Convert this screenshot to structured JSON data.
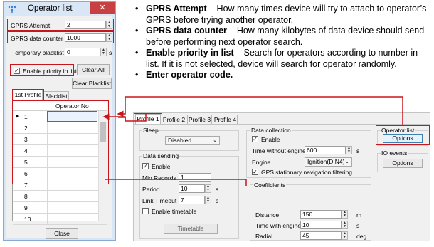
{
  "dialog": {
    "title": "Operator list",
    "close_glyph": "✕",
    "gprs_attempt": {
      "label": "GPRS Attempt",
      "value": "2"
    },
    "gprs_counter": {
      "label": "GPRS data counter",
      "value": "1000"
    },
    "temp_blacklist": {
      "label": "Temporary blacklist",
      "value": "0",
      "unit": "s"
    },
    "enable_priority": {
      "label": "Enable priority in list",
      "checked": true
    },
    "clear_all": "Clear All",
    "clear_blacklist": "Clear Blacklist",
    "tabs": [
      "1st Profile",
      "Blacklist"
    ],
    "grid_header": "Operator No",
    "row_numbers": [
      "1",
      "2",
      "3",
      "4",
      "5",
      "6",
      "7",
      "8",
      "9",
      "10"
    ],
    "close_button": "Close"
  },
  "bullets": [
    {
      "bold": "GPRS Attempt",
      "text": " – How many times device will try to attach to operator’s GPRS before trying another operator."
    },
    {
      "bold": "GPRS data counter",
      "text": " – How many kilobytes of data device should send before performing next operator search."
    },
    {
      "bold": "Enable priority in list",
      "text": " – Search for operators according to number in list. If it is not selected, device will search for operator randomly."
    },
    {
      "bold": "Enter operator code.",
      "text": ""
    }
  ],
  "panel": {
    "tabs": [
      "Profile 1",
      "Profile 2",
      "Profile 3",
      "Profile 4"
    ],
    "sleep": {
      "title": "Sleep",
      "mode": "Disabled"
    },
    "data_sending": {
      "title": "Data sending",
      "enable": "Enable",
      "min_records": {
        "label": "Min Records",
        "value": "1"
      },
      "period": {
        "label": "Period",
        "value": "10",
        "unit": "s"
      },
      "link_timeout": {
        "label": "Link Timeout",
        "value": "7",
        "unit": "s"
      },
      "enable_timetable": "Enable timetable",
      "timetable_button": "Timetable"
    },
    "data_collection": {
      "title": "Data collection",
      "enable": "Enable",
      "time_without_engine": {
        "label": "Time without engine",
        "value": "600",
        "unit": "s"
      },
      "engine": {
        "label": "Engine",
        "value": "Ignition(DIN4)"
      },
      "gps_filter": "GPS stationary navigation filtering"
    },
    "coefficients": {
      "title": "Coefficients",
      "distance": {
        "label": "Distance",
        "value": "150",
        "unit": "m"
      },
      "time_with_engine": {
        "label": "Time with engine",
        "value": "10",
        "unit": "s"
      },
      "radial": {
        "label": "Radial",
        "value": "45",
        "unit": "deg"
      }
    },
    "operator_list": {
      "title": "Operator list",
      "button": "Options"
    },
    "io_events": {
      "title": "IO events",
      "button": "Options"
    }
  }
}
